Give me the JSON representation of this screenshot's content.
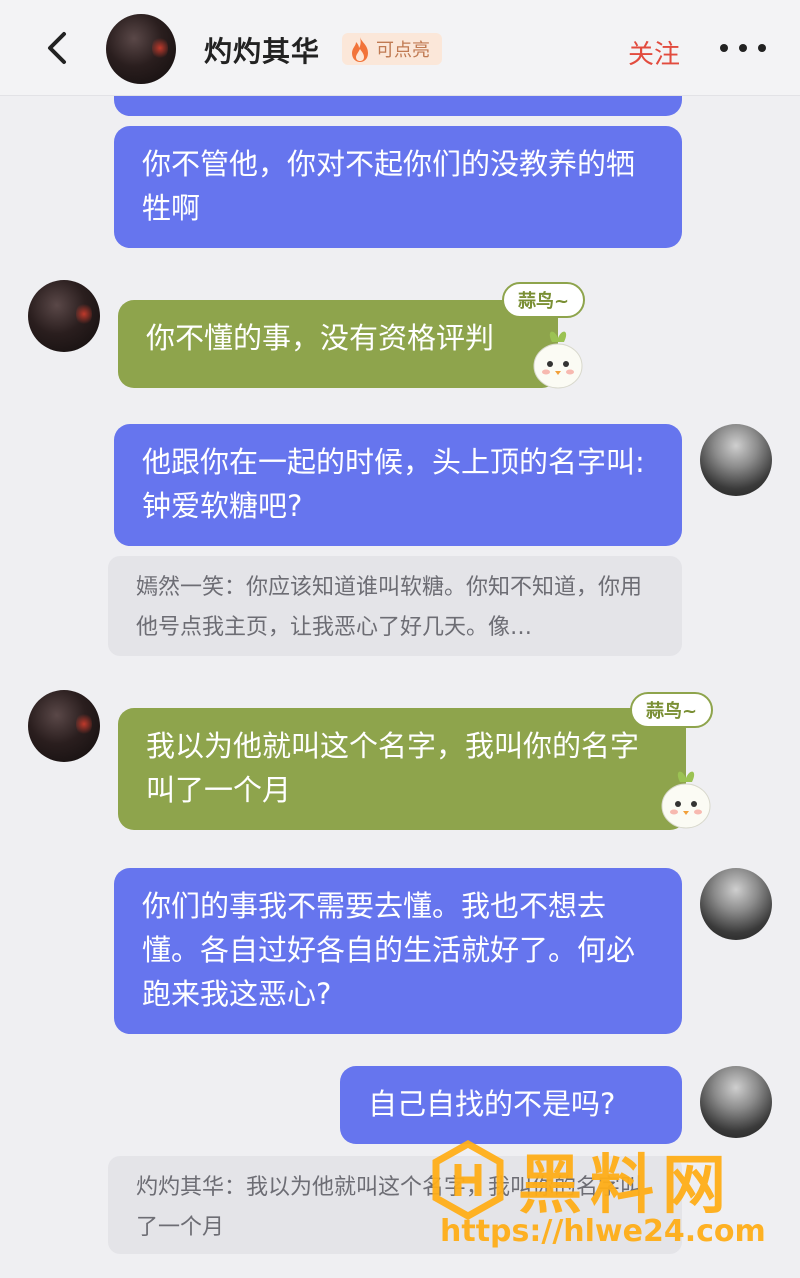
{
  "header": {
    "title": "灼灼其华",
    "badge_text": "可点亮",
    "follow_label": "关注"
  },
  "messages": {
    "m1": "你不管他，你对不起你们的没教养的牺牲啊",
    "m2": "你不懂的事，没有资格评判",
    "m3": "他跟你在一起的时候，头上顶的名字叫:钟爱软糖吧?",
    "q1": "嫣然一笑：你应该知道谁叫软糖。你知不知道，你用他号点我主页，让我恶心了好几天。像…",
    "m4": "我以为他就叫这个名字，我叫你的名字叫了一个月",
    "m5": "你们的事我不需要去懂。我也不想去懂。各自过好各自的生活就好了。何必跑来我这恶心?",
    "m6": "自己自找的不是吗?",
    "q2": "灼灼其华：我以为他就叫这个名字，我叫你的名字叫了一个月"
  },
  "tags": {
    "t1": "蒜鸟~",
    "t2": "蒜鸟~"
  },
  "watermark": {
    "title": "黑料网",
    "url": "https://hlwe24.com"
  },
  "colors": {
    "self_bubble": "#6675ee",
    "other_bubble": "#8ea44c",
    "follow": "#e24b3e",
    "watermark": "#ffae18"
  },
  "icons": [
    "back-arrow-icon",
    "fire-icon",
    "more-icon",
    "sticker-icon",
    "watermark-logo-icon"
  ]
}
